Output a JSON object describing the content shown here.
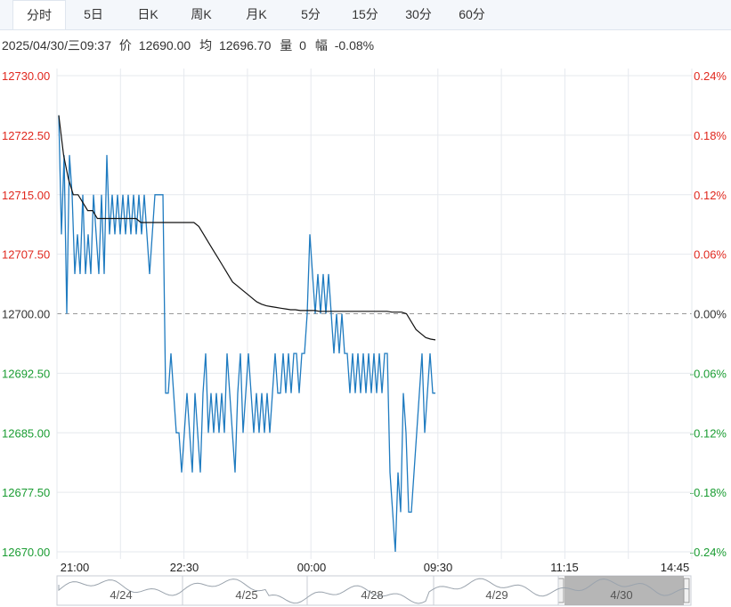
{
  "tabs": [
    {
      "label": "分时",
      "active": true
    },
    {
      "label": "5日",
      "active": false
    },
    {
      "label": "日K",
      "active": false
    },
    {
      "label": "周K",
      "active": false
    },
    {
      "label": "月K",
      "active": false
    },
    {
      "label": "5分",
      "active": false
    },
    {
      "label": "15分",
      "active": false
    },
    {
      "label": "30分",
      "active": false
    },
    {
      "label": "60分",
      "active": false
    }
  ],
  "info": {
    "datetime": "2025/04/30/三09:37",
    "price_label": "价",
    "price": "12690.00",
    "avg_label": "均",
    "avg": "12696.70",
    "vol_label": "量",
    "vol": "0",
    "amp_label": "幅",
    "amp": "-0.08%"
  },
  "colors": {
    "up": "#e0281e",
    "down": "#1a9c32",
    "price_line": "#1f7bc0",
    "avg_line": "#111111",
    "grid": "#e6e9ee"
  },
  "navigator": {
    "labels": [
      "4/24",
      "4/25",
      "4/28",
      "4/29",
      "4/30"
    ]
  },
  "chart_data": {
    "type": "line",
    "title": "",
    "base_price": 12700.0,
    "y_ticks_left": [
      "12730.00",
      "12722.50",
      "12715.00",
      "12707.50",
      "12700.00",
      "12692.50",
      "12685.00",
      "12677.50",
      "12670.00"
    ],
    "y_ticks_right": [
      "0.24%",
      "0.18%",
      "0.12%",
      "0.06%",
      "0.00%",
      "-0.06%",
      "-0.12%",
      "-0.18%",
      "-0.24%"
    ],
    "x_ticks": [
      "21:00",
      "22:30",
      "00:00",
      "09:30",
      "11:15",
      "14:45"
    ],
    "ylim": [
      12670.0,
      12730.0
    ],
    "series": [
      {
        "values": [
          12725,
          12710,
          12720,
          12700,
          12720,
          12715,
          12705,
          12710,
          12705,
          12715,
          12705,
          12710,
          12705,
          12715,
          12710,
          12705,
          12715,
          12705,
          12720,
          12710,
          12715,
          12710,
          12715,
          12710,
          12715,
          12710,
          12715,
          12710,
          12715,
          12710,
          12715,
          12710,
          12715,
          12710,
          12705,
          12710,
          12715,
          12715,
          12715,
          12715,
          12690,
          12690,
          12695,
          12690,
          12685,
          12685,
          12680,
          12685,
          12690,
          12685,
          12680,
          12690,
          12685,
          12680,
          12690,
          12695,
          12685,
          12690,
          12685,
          12690,
          12685,
          12690,
          12685,
          12695,
          12690,
          12685,
          12680,
          12690,
          12695,
          12685,
          12690,
          12695,
          12690,
          12685,
          12690,
          12685,
          12690,
          12685,
          12690,
          12685,
          12690,
          12695,
          12690,
          12690,
          12695,
          12690,
          12695,
          12690,
          12695,
          12695,
          12690,
          12695,
          12695,
          12700,
          12710,
          12705,
          12700,
          12705,
          12700,
          12705,
          12700,
          12705,
          12700,
          12695,
          12700,
          12695,
          12700,
          12695,
          12695,
          12690,
          12695,
          12690,
          12695,
          12690,
          12695,
          12690,
          12695,
          12690,
          12695,
          12690,
          12695,
          12690,
          12695,
          12695,
          12680,
          12675,
          12670,
          12680,
          12675,
          12690,
          12685,
          12675,
          12675,
          12680,
          12685,
          12690,
          12695,
          12685,
          12690,
          12695,
          12690,
          12690
        ]
      },
      {
        "values": [
          12725,
          12720,
          12717,
          12715,
          12715,
          12714,
          12713,
          12713,
          12712,
          12712,
          12712,
          12712,
          12712,
          12712,
          12712,
          12712,
          12712,
          12711.5,
          12711.5,
          12711.5,
          12711.5,
          12711.5,
          12711.5,
          12711.5,
          12711.5,
          12711.5,
          12711.5,
          12711.5,
          12711.5,
          12711,
          12710,
          12709,
          12708,
          12707,
          12706,
          12705,
          12704,
          12703.5,
          12703,
          12702.5,
          12702,
          12701.5,
          12701.2,
          12701,
          12700.9,
          12700.8,
          12700.7,
          12700.6,
          12700.5,
          12700.5,
          12700.4,
          12700.4,
          12700.4,
          12700.4,
          12700.3,
          12700.3,
          12700.3,
          12700.3,
          12700.3,
          12700.3,
          12700.3,
          12700.3,
          12700.3,
          12700.3,
          12700.3,
          12700.3,
          12700.3,
          12700.3,
          12700.3,
          12700.2,
          12700.2,
          12700.2,
          12700,
          12699,
          12698,
          12697.5,
          12697,
          12696.8,
          12696.7
        ]
      }
    ]
  }
}
